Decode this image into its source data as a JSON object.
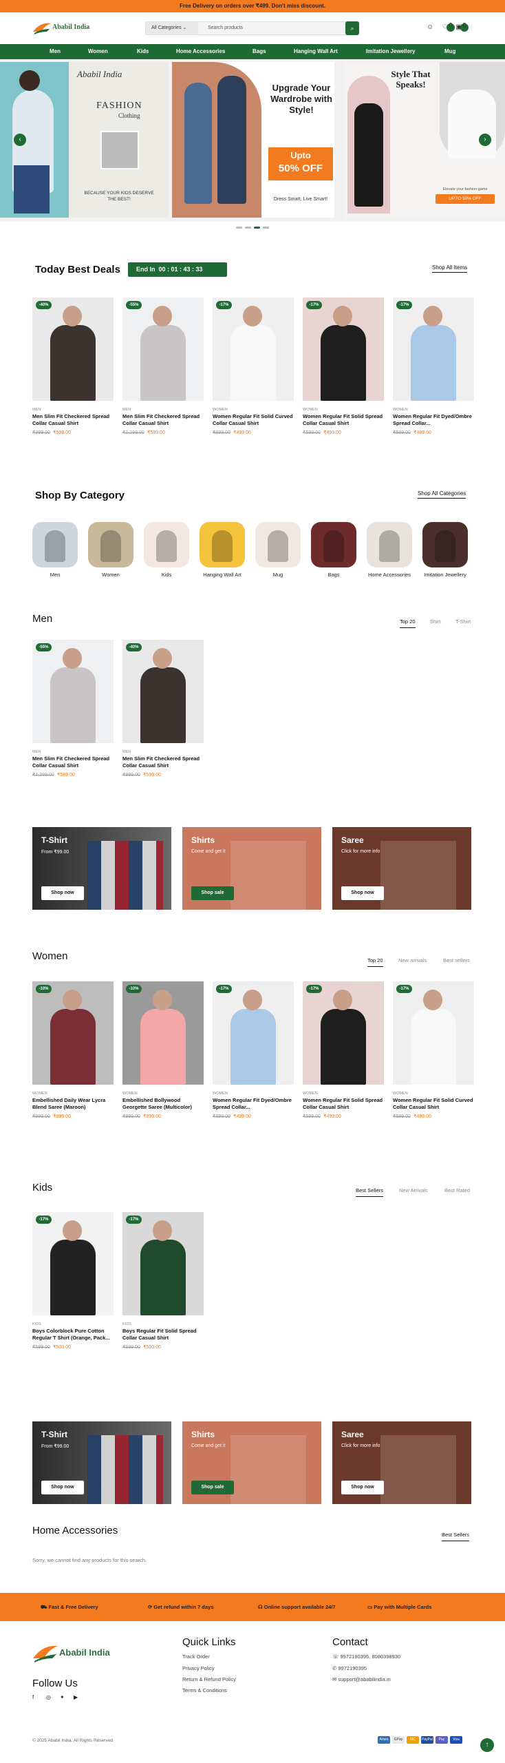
{
  "topbar": {
    "text": "Free Delivery on orders over ₹499. Don't miss discount."
  },
  "header": {
    "logo_text": "Ababil India",
    "search_category": "All Categories",
    "search_placeholder": "Search products",
    "wishlist_count": "0",
    "cart_count": "0"
  },
  "nav": [
    "Men",
    "Women",
    "Kids",
    "Home Accessories",
    "Bags",
    "Hanging Wall Art",
    "Imitation Jewellery",
    "Mug"
  ],
  "hero": {
    "left_script": "Ababil India",
    "left_title": "FASHION",
    "left_sub": "Clothing",
    "left_tag": "BECAUSE YOUR KIDS DESERVE THE BEST!",
    "mid_title": "Upgrade Your Wardrobe with Style!",
    "mid_offer_1": "Upto",
    "mid_offer_2": "50% OFF",
    "mid_tag": "Dress Smart, Live Smart!",
    "right_title": "Style That Speaks!",
    "right_sub": "Elevate your fashion game",
    "right_btn": "UPTO 50% OFF"
  },
  "deals": {
    "title": "Today Best Deals",
    "timer_label": "End In",
    "timer": "00 : 01 : 43 : 33",
    "link": "Shop All Items",
    "products": [
      {
        "disc": "-40%",
        "cat": "MEN",
        "name": "Men Slim Fit Checkered Spread Collar Casual Shirt",
        "old": "₹999.00",
        "new": "₹599.00"
      },
      {
        "disc": "-55%",
        "cat": "MEN",
        "name": "Men Slim Fit Checkered Spread Collar Casual Shirt",
        "old": "₹1,299.00",
        "new": "₹589.00"
      },
      {
        "disc": "-17%",
        "cat": "WOMEN",
        "name": "Women Regular Fit Solid Curved Collar Casual Shirt",
        "old": "₹599.00",
        "new": "₹499.00"
      },
      {
        "disc": "-17%",
        "cat": "WOMEN",
        "name": "Women Regular Fit Solid Spread Collar Casual Shirt",
        "old": "₹599.00",
        "new": "₹499.00"
      },
      {
        "disc": "-17%",
        "cat": "WOMEN",
        "name": "Women Regular Fit Dyed/Ombre Spread Collar...",
        "old": "₹599.00",
        "new": "₹499.00"
      }
    ]
  },
  "categories": {
    "title": "Shop By Category",
    "link": "Shop All Categories",
    "items": [
      "Men",
      "Women",
      "Kids",
      "Hanging Wall Art",
      "Mug",
      "Bags",
      "Home Accessories",
      "Imitation Jewellery"
    ]
  },
  "men": {
    "title": "Men",
    "tabs": [
      "Top 20",
      "Shirt",
      "T-Shirt"
    ],
    "products": [
      {
        "disc": "-55%",
        "cat": "MEN",
        "name": "Men Slim Fit Checkered Spread Collar Casual Shirt",
        "old": "₹1,299.00",
        "new": "₹589.00"
      },
      {
        "disc": "-40%",
        "cat": "MEN",
        "name": "Men Slim Fit Checkered Spread Collar Casual Shirt",
        "old": "₹999.00",
        "new": "₹599.00"
      }
    ]
  },
  "banners": [
    {
      "title": "T-Shirt",
      "sub": "From ₹99.00",
      "btn": "Shop now"
    },
    {
      "title": "Shirts",
      "sub": "Come and get it",
      "btn": "Shop sale"
    },
    {
      "title": "Saree",
      "sub": "Click for more info",
      "btn": "Shop now"
    }
  ],
  "women": {
    "title": "Women",
    "tabs": [
      "Top 20",
      "New arrivals",
      "Best sellers"
    ],
    "products": [
      {
        "disc": "-10%",
        "cat": "WOMEN",
        "name": "Embellished Daily Wear Lycra Blend Saree (Maroon)",
        "old": "₹999.00",
        "new": "₹899.00"
      },
      {
        "disc": "-10%",
        "cat": "WOMEN",
        "name": "Embellished Bollywood Georgette Saree (Multicolor)",
        "old": "₹999.00",
        "new": "₹899.00"
      },
      {
        "disc": "-17%",
        "cat": "WOMEN",
        "name": "Women Regular Fit Dyed/Ombre Spread Collar...",
        "old": "₹599.00",
        "new": "₹499.00"
      },
      {
        "disc": "-17%",
        "cat": "WOMEN",
        "name": "Women Regular Fit Solid Spread Collar Casual Shirt",
        "old": "₹599.00",
        "new": "₹499.00"
      },
      {
        "disc": "-17%",
        "cat": "WOMEN",
        "name": "Women Regular Fit Solid Curved Collar Casual Shirt",
        "old": "₹599.00",
        "new": "₹499.00"
      }
    ]
  },
  "kids": {
    "title": "Kids",
    "tabs": [
      "Best Sellers",
      "New Arrivals",
      "Best Rated"
    ],
    "products": [
      {
        "disc": "-17%",
        "cat": "KIDS",
        "name": "Boys Colorblock Pure Cotton Regular T Shirt (Orange, Pack...",
        "old": "₹599.00",
        "new": "₹500.00"
      },
      {
        "disc": "-17%",
        "cat": "KIDS",
        "name": "Boys Regular Fit Solid Spread Collar Casual Shirt",
        "old": "₹599.00",
        "new": "₹500.00"
      }
    ]
  },
  "home_acc": {
    "title": "Home Accessories",
    "tab": "Best Sellers",
    "empty": "Sorry, we cannot find any products for this search."
  },
  "services": [
    "Fast & Free Delivery",
    "Get refund within 7 days",
    "Online support available 24/7",
    "Pay with Multiple Cards"
  ],
  "footer": {
    "logo_text": "Ababil India",
    "follow": "Follow Us",
    "quick_title": "Quick Links",
    "quick_links": [
      "Track Order",
      "Privacy Policy",
      "Return & Refund Policy",
      "Terms & Conditions"
    ],
    "contact_title": "Contact",
    "phones": "9972190395, 8080398930",
    "phone2": "9972190395",
    "email": "support@ababilindia.in",
    "copyright": "© 2025 Ababil India. All Rights Reserved.",
    "payments": [
      "Amex",
      "GPay",
      "MC",
      "PayPal",
      "Pay",
      "Visa"
    ]
  },
  "colors": {
    "brand_green": "#1f6a35",
    "brand_orange": "#f47a1f"
  }
}
